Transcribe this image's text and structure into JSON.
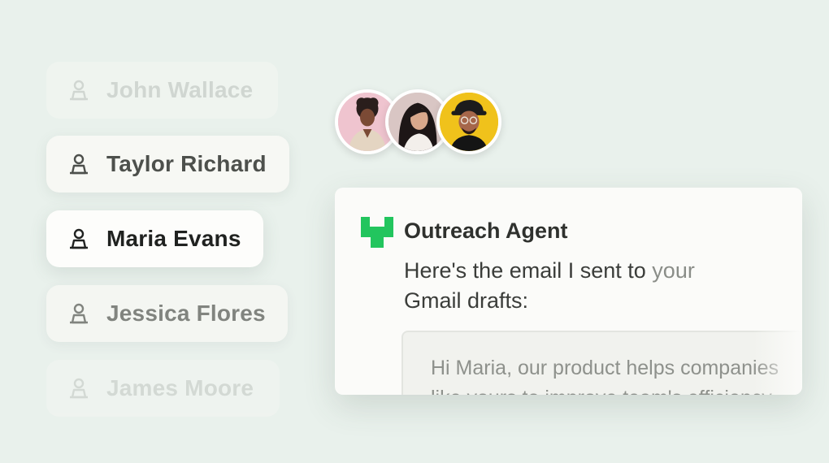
{
  "contacts": [
    {
      "name": "John Wallace",
      "icon": "person-icon"
    },
    {
      "name": "Taylor Richard",
      "icon": "person-icon"
    },
    {
      "name": "Maria Evans",
      "icon": "person-icon",
      "selected": true
    },
    {
      "name": "Jessica Flores",
      "icon": "person-icon"
    },
    {
      "name": "James Moore",
      "icon": "person-icon"
    }
  ],
  "avatars": [
    {
      "icon": "avatar-woman-curly-hair"
    },
    {
      "icon": "avatar-woman-long-hair"
    },
    {
      "icon": "avatar-man-cap-glasses"
    }
  ],
  "agent": {
    "logo": "outreach-logo-icon",
    "name": "Outreach Agent",
    "message_main": "Here's the email I sent to ",
    "message_fade": "your",
    "message_line2": "Gmail drafts:",
    "email_line1": "Hi Maria, our product helps companies",
    "email_line2": "like yours to improve team's efficiency"
  },
  "colors": {
    "background": "#e9f1ec",
    "logo_green": "#22c55e",
    "card": "#fbfbf9"
  }
}
